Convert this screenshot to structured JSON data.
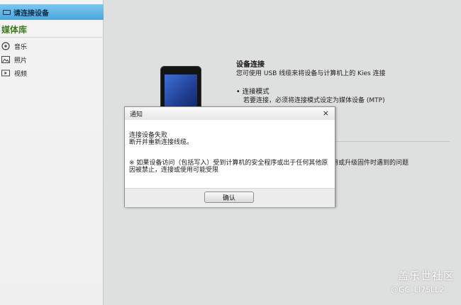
{
  "sidebar": {
    "connect_label": "请连接设备",
    "library_title": "媒体库",
    "items": [
      {
        "label": "音乐",
        "icon": "music-disc-icon"
      },
      {
        "label": "照片",
        "icon": "photo-icon"
      },
      {
        "label": "视频",
        "icon": "video-icon"
      }
    ]
  },
  "main": {
    "connection_title": "设备连接",
    "connection_desc": "您可使用 USB 线缆来将设备与计算机上的 Kies 连接",
    "mode_title": "• 连接模式",
    "mode_desc": "若要连接，必须将连接模式设定为媒体设备 (MTP)",
    "partial_text": "用或升级固件时遇到的问题"
  },
  "dialog": {
    "title": "通知",
    "close_glyph": "×",
    "message_line1": "连接设备失败",
    "message_line2": "断开并重新连接线缆。",
    "note_line1": "※ 如果设备访问（包括写入）受到计算机的安全程序或出于任何其他原",
    "note_line2": "因被禁止，连接或使用可能受限",
    "ok_label": "确认"
  },
  "watermark": {
    "title": "盖乐世社区",
    "handle": "@GC_LI75LL2"
  },
  "colors": {
    "connect_header": "#4aa6dd",
    "library_title": "#3e7d1d",
    "background": "#dedfdf"
  }
}
